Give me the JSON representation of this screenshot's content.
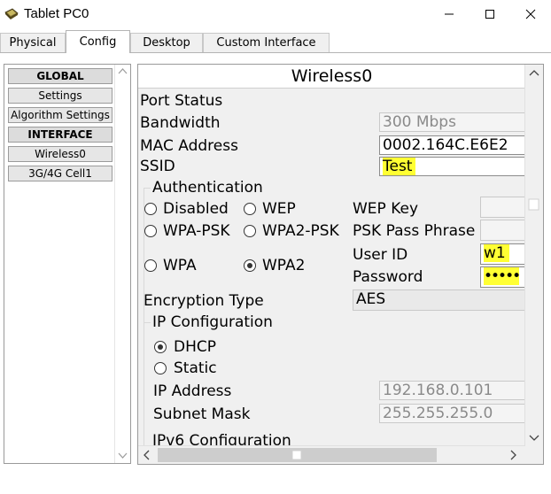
{
  "window": {
    "title": "Tablet PC0"
  },
  "tabs": [
    {
      "label": "Physical"
    },
    {
      "label": "Config"
    },
    {
      "label": "Desktop"
    },
    {
      "label": "Custom Interface"
    }
  ],
  "sidebar": {
    "items": [
      {
        "label": "GLOBAL"
      },
      {
        "label": "Settings"
      },
      {
        "label": "Algorithm Settings"
      },
      {
        "label": "INTERFACE"
      },
      {
        "label": "Wireless0"
      },
      {
        "label": "3G/4G Cell1"
      }
    ]
  },
  "panel": {
    "heading": "Wireless0",
    "port_status": "Port Status",
    "bandwidth_label": "Bandwidth",
    "bandwidth_value": "300 Mbps",
    "mac_label": "MAC Address",
    "mac_value": "0002.164C.E6E2",
    "ssid_label": "SSID",
    "ssid_value": "Test",
    "auth": {
      "title": "Authentication",
      "disabled": "Disabled",
      "wep": "WEP",
      "wpa_psk": "WPA-PSK",
      "wpa2_psk": "WPA2-PSK",
      "wpa": "WPA",
      "wpa2": "WPA2",
      "wep_key_label": "WEP Key",
      "psk_label": "PSK Pass Phrase",
      "user_id_label": "User ID",
      "user_id_value": "w1",
      "password_label": "Password",
      "password_value": "•••••",
      "selected": "WPA2"
    },
    "encryption_label": "Encryption Type",
    "encryption_value": "AES",
    "ip": {
      "title": "IP Configuration",
      "dhcp": "DHCP",
      "static": "Static",
      "selected": "DHCP",
      "ip_label": "IP Address",
      "ip_value": "192.168.0.101",
      "mask_label": "Subnet Mask",
      "mask_value": "255.255.255.0"
    },
    "ipv6_title": "IPv6 Configuration"
  },
  "colors": {
    "highlight": "#ffff33"
  }
}
